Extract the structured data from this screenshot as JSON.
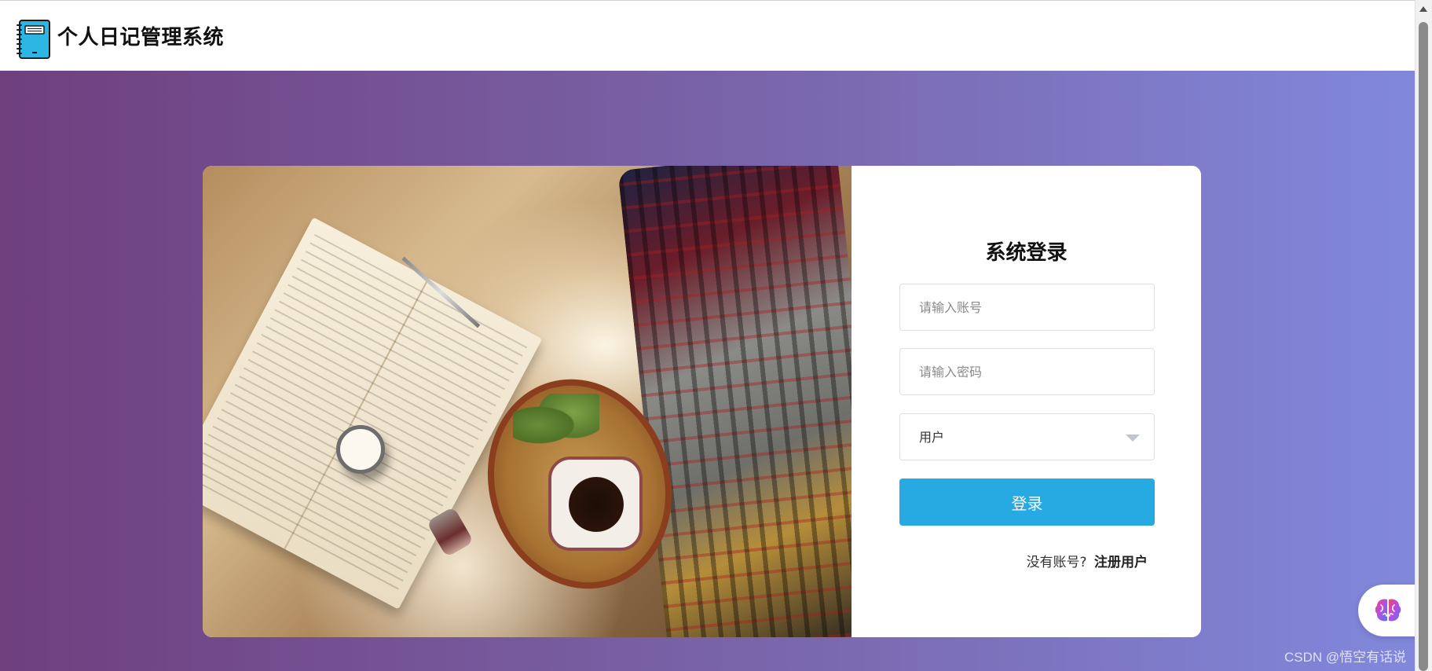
{
  "header": {
    "title": "个人日记管理系统",
    "logo_icon": "notebook-icon"
  },
  "login": {
    "title": "系统登录",
    "username_placeholder": "请输入账号",
    "password_placeholder": "请输入密码",
    "role_value": "用户",
    "submit_label": "登录",
    "no_account_text": "没有账号?",
    "register_label": "注册用户"
  },
  "floating": {
    "icon": "brain-icon"
  },
  "watermark": "CSDN @悟空有话说",
  "colors": {
    "accent": "#27a9e1",
    "gradient_start": "#6f3f7e",
    "gradient_end": "#8188dc"
  }
}
